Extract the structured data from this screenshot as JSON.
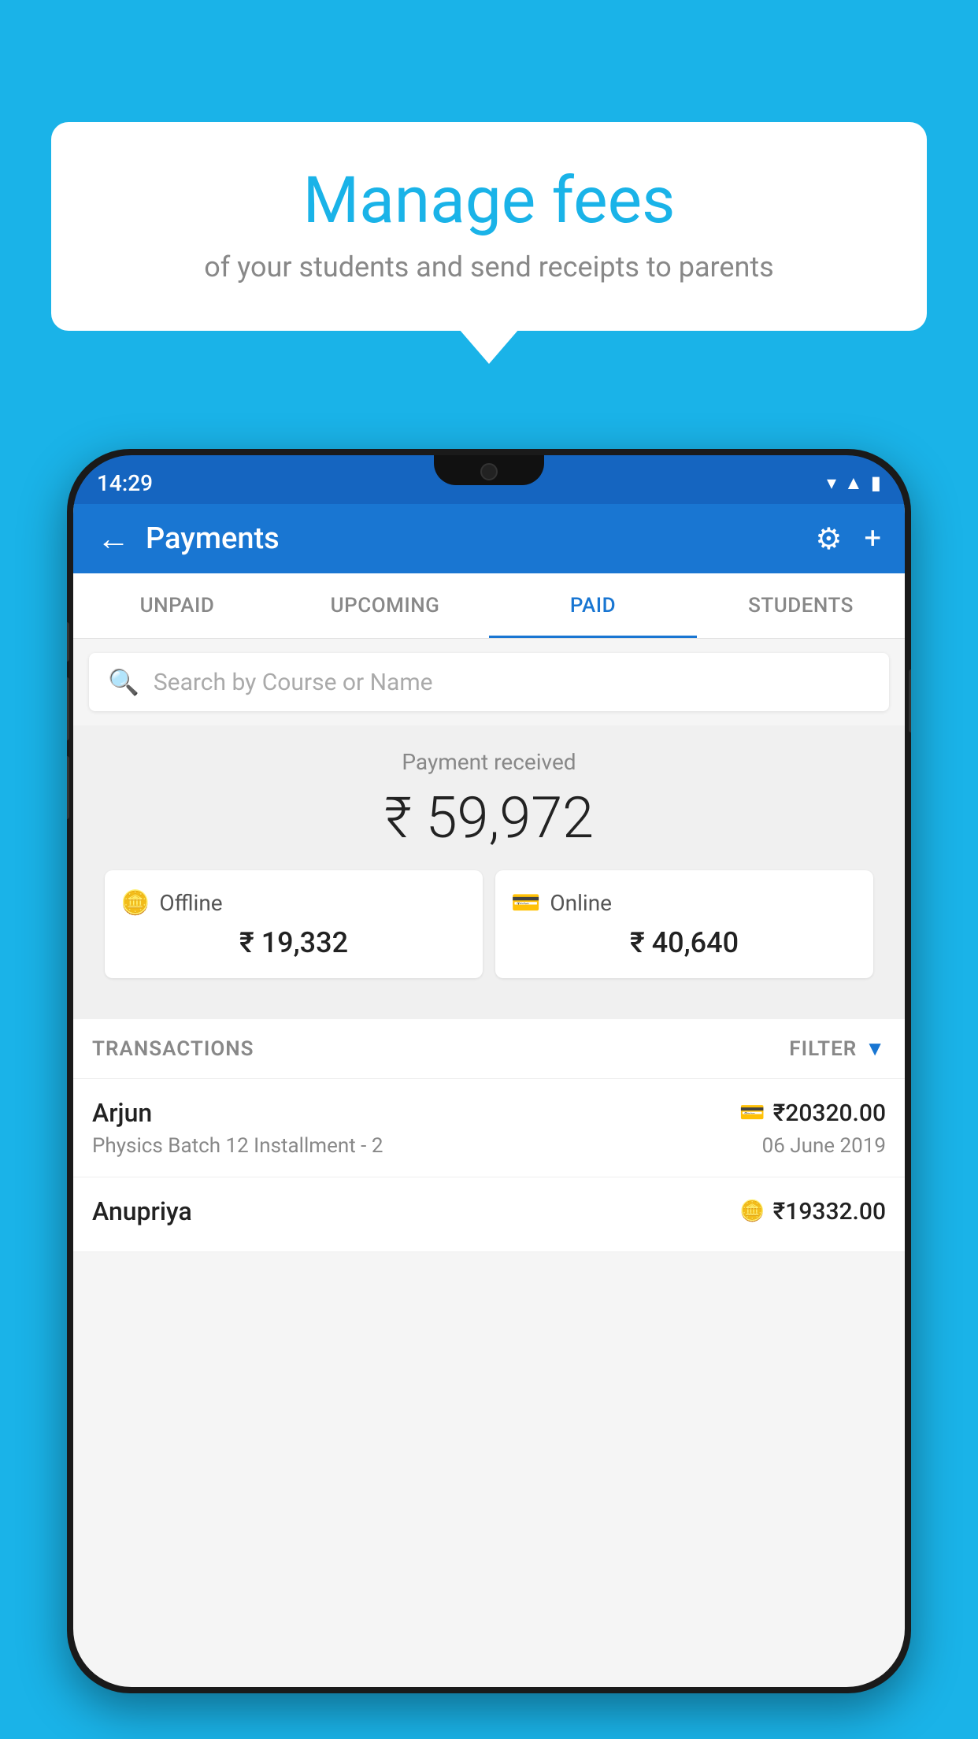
{
  "background_color": "#1ab3e8",
  "bubble": {
    "title": "Manage fees",
    "subtitle": "of your students and send receipts to parents"
  },
  "status_bar": {
    "time": "14:29",
    "wifi_icon": "▾",
    "signal_icon": "▲",
    "battery_icon": "▮"
  },
  "header": {
    "back_label": "←",
    "title": "Payments",
    "gear_label": "⚙",
    "plus_label": "+"
  },
  "tabs": [
    {
      "label": "UNPAID",
      "active": false
    },
    {
      "label": "UPCOMING",
      "active": false
    },
    {
      "label": "PAID",
      "active": true
    },
    {
      "label": "STUDENTS",
      "active": false
    }
  ],
  "search": {
    "placeholder": "Search by Course or Name"
  },
  "payment_received": {
    "label": "Payment received",
    "amount": "₹ 59,972"
  },
  "payment_cards": [
    {
      "icon": "offline",
      "label": "Offline",
      "amount": "₹ 19,332"
    },
    {
      "icon": "online",
      "label": "Online",
      "amount": "₹ 40,640"
    }
  ],
  "transactions": {
    "label": "TRANSACTIONS",
    "filter_label": "FILTER"
  },
  "transaction_rows": [
    {
      "name": "Arjun",
      "icon_type": "card",
      "amount": "₹20320.00",
      "desc": "Physics Batch 12 Installment - 2",
      "date": "06 June 2019"
    },
    {
      "name": "Anupriya",
      "icon_type": "cash",
      "amount": "₹19332.00",
      "desc": "",
      "date": ""
    }
  ]
}
